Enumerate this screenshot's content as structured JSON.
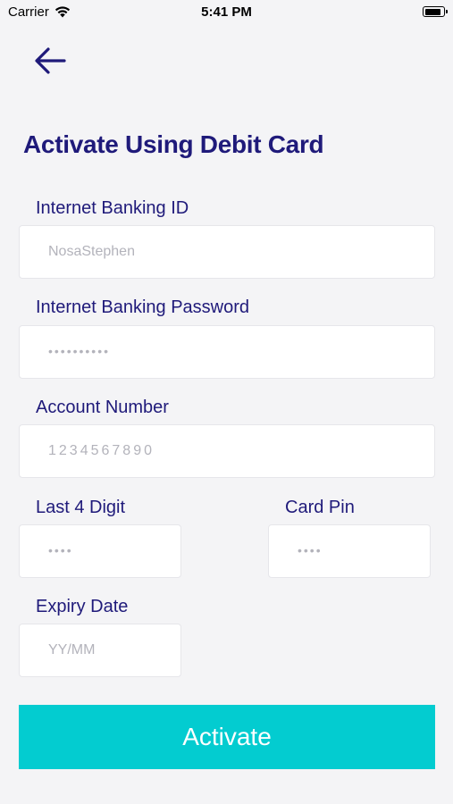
{
  "status_bar": {
    "carrier": "Carrier",
    "time": "5:41 PM",
    "battery_level": 0.9
  },
  "header": {
    "back_icon": "arrow-left-icon",
    "title": "Activate Using Debit Card"
  },
  "form": {
    "internet_banking_id": {
      "label": "Internet Banking ID",
      "placeholder": "NosaStephen"
    },
    "internet_banking_password": {
      "label": "Internet Banking Password",
      "placeholder": "••••••••••"
    },
    "account_number": {
      "label": "Account Number",
      "placeholder": "1234567890"
    },
    "last4": {
      "label": "Last 4 Digit",
      "placeholder": "••••"
    },
    "card_pin": {
      "label": "Card Pin",
      "placeholder": "••••"
    },
    "expiry_date": {
      "label": "Expiry Date",
      "placeholder": "YY/MM"
    }
  },
  "actions": {
    "activate_label": "Activate"
  },
  "colors": {
    "accent": "#1f1a7a",
    "button": "#03ccd0",
    "background": "#f4f4f6"
  }
}
